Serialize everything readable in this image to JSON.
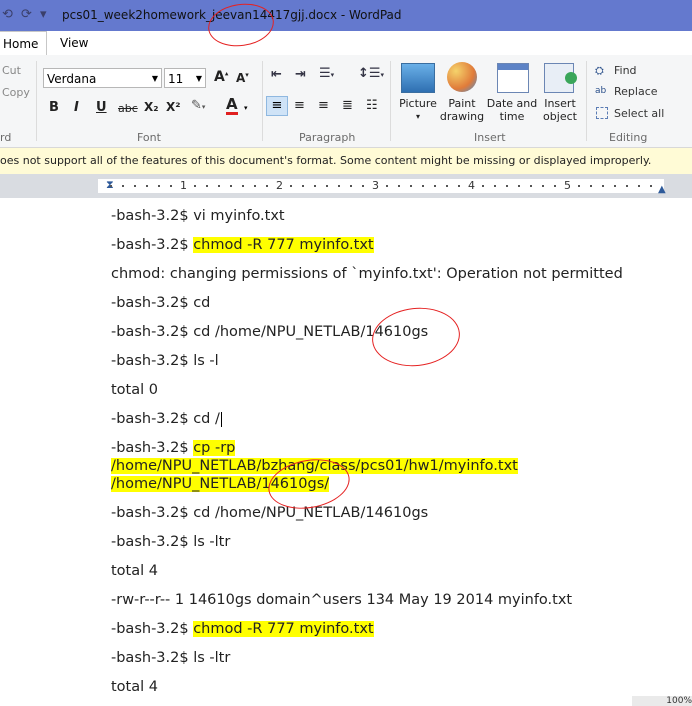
{
  "window": {
    "title": "pcs01_week2homework_jeevan14417gjj.docx - WordPad"
  },
  "tabs": [
    {
      "label": "Home"
    },
    {
      "label": "View"
    }
  ],
  "clipboard": {
    "cut": "Cut",
    "copy": "Copy",
    "group_label": "rd"
  },
  "font": {
    "family": "Verdana",
    "size": "11",
    "group_label": "Font",
    "bold": "B",
    "italic": "I",
    "underline": "U",
    "strike": "abc",
    "subscript": "X₂",
    "superscript": "X²"
  },
  "paragraph": {
    "group_label": "Paragraph"
  },
  "insert": {
    "group_label": "Insert",
    "picture": "Picture",
    "paint1": "Paint",
    "paint2": "drawing",
    "date1": "Date and",
    "date2": "time",
    "object1": "Insert",
    "object2": "object"
  },
  "editing": {
    "group_label": "Editing",
    "find": "Find",
    "replace": "Replace",
    "select_all": "Select all"
  },
  "warning": "oes not support all of the features of this document's format. Some content might be missing or displayed improperly.",
  "ruler": {
    "numbers": [
      "1",
      "2",
      "3",
      "4",
      "5"
    ]
  },
  "document": {
    "line0": "-bash-3.2$ vi myinfo.txt",
    "line1_prompt": "-bash-3.2$ ",
    "line1_cmd": "chmod -R 777 myinfo.txt",
    "line2": "chmod: changing permissions of `myinfo.txt': Operation not permitted",
    "line3": "-bash-3.2$ cd",
    "line4": "-bash-3.2$ cd /home/NPU_NETLAB/14610gs",
    "line5": "-bash-3.2$ ls -l",
    "line6": "total 0",
    "line7": "-bash-3.2$ cd /",
    "line8_prompt": "-bash-3.2$ ",
    "line8_cmd": "cp -rp",
    "line9": "/home/NPU_NETLAB/bzhang/class/pcs01/hw1/myinfo.txt",
    "line10": "/home/NPU_NETLAB/14610gs/",
    "line11": "-bash-3.2$ cd /home/NPU_NETLAB/14610gs",
    "line12": "-bash-3.2$ ls -ltr",
    "line13": "total 4",
    "line14": "-rw-r--r-- 1 14610gs domain^users 134 May 19  2014 myinfo.txt",
    "line15_prompt": "-bash-3.2$ ",
    "line15_cmd": "chmod -R 777 myinfo.txt",
    "line16": "-bash-3.2$ ls -ltr",
    "line17": "total 4"
  },
  "status": {
    "zoom": "100%"
  }
}
